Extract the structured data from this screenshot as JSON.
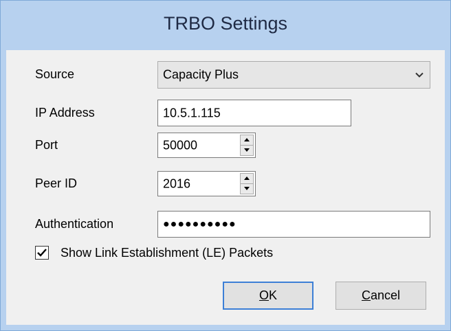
{
  "window": {
    "title": "TRBO Settings"
  },
  "form": {
    "source_label": "Source",
    "source_value": "Capacity Plus",
    "ip_label": "IP Address",
    "ip_value": "10.5.1.115",
    "port_label": "Port",
    "port_value": "50000",
    "peer_label": "Peer ID",
    "peer_value": "2016",
    "auth_label": "Authentication",
    "auth_value": "●●●●●●●●●●",
    "le_label": "Show Link Establishment (LE) Packets",
    "le_checked": true
  },
  "buttons": {
    "ok_mnemonic": "O",
    "ok_rest": "K",
    "cancel_mnemonic": "C",
    "cancel_rest": "ancel"
  },
  "icons": {
    "dropdown": "chevron-down-icon",
    "spin_up": "triangle-up-icon",
    "spin_down": "triangle-down-icon",
    "check": "checkmark-icon"
  },
  "colors": {
    "title_bar": "#b7d1ef",
    "client": "#f0f0f0",
    "default_button_border": "#3c7fd6"
  }
}
